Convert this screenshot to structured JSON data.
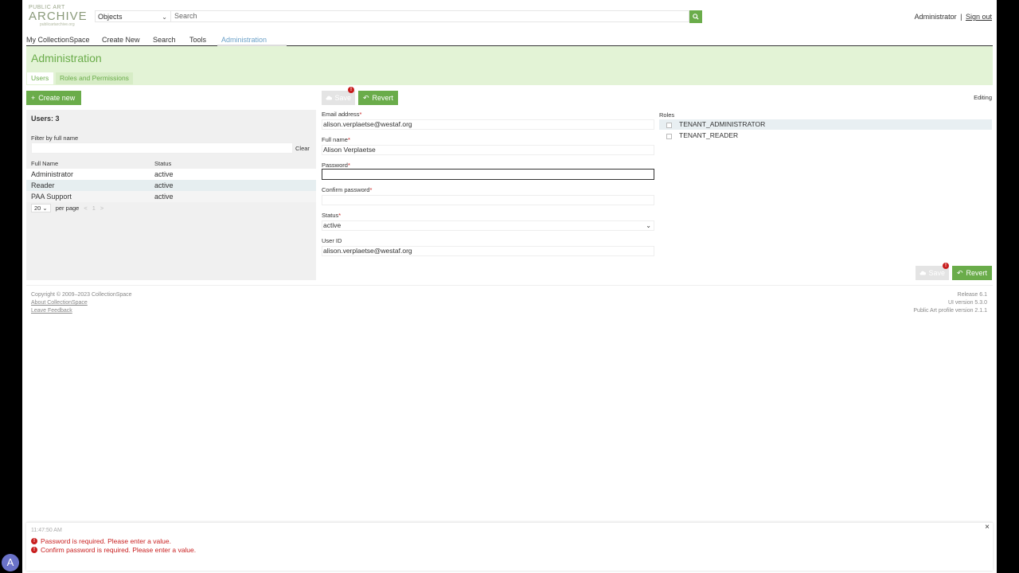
{
  "header": {
    "logo_line1": "PUBLIC ART",
    "logo_line2": "ARCHIVE",
    "logo_line3": "publicartarchive.org",
    "record_type": "Objects",
    "search_placeholder": "Search",
    "user_name": "Administrator",
    "separator": "|",
    "sign_out": "Sign out"
  },
  "nav": {
    "items": [
      "My CollectionSpace",
      "Create New",
      "Search",
      "Tools",
      "Administration"
    ]
  },
  "admin": {
    "title": "Administration",
    "tabs": [
      "Users",
      "Roles and Permissions"
    ]
  },
  "left": {
    "create_new": "Create new",
    "users_count": "Users: 3",
    "filter_label": "Filter by full name",
    "clear": "Clear",
    "columns": [
      "Full Name",
      "Status"
    ],
    "rows": [
      {
        "name": "Administrator",
        "status": "active"
      },
      {
        "name": "Reader",
        "status": "active"
      },
      {
        "name": "PAA Support",
        "status": "active"
      }
    ],
    "page_size": "20",
    "per_page": "per page",
    "page_prev": "<",
    "page_num": "1",
    "page_next": ">"
  },
  "toolbar": {
    "save": "Save",
    "revert": "Revert",
    "editing": "Editing",
    "error_badge": "!"
  },
  "form": {
    "email_label": "Email address",
    "email_value": "alison.verplaetse@westaf.org",
    "fullname_label": "Full name",
    "fullname_value": "Alison Verplaetse",
    "password_label": "Password",
    "password_value": "",
    "confirm_label": "Confirm password",
    "confirm_value": "",
    "status_label": "Status",
    "status_value": "active",
    "userid_label": "User ID",
    "userid_value": "alison.verplaetse@westaf.org",
    "required_mark": "*"
  },
  "roles": {
    "label": "Roles",
    "items": [
      "TENANT_ADMINISTRATOR",
      "TENANT_READER"
    ]
  },
  "footer": {
    "copyright": "Copyright © 2009–2023 CollectionSpace",
    "about": "About CollectionSpace",
    "feedback": "Leave Feedback",
    "release": "Release 6.1",
    "ui_version": "UI version 5.3.0",
    "profile_version": "Public Art profile version 2.1.1"
  },
  "notification": {
    "time": "11:47:50 AM",
    "messages": [
      "Password is required. Please enter a value.",
      "Confirm password is required. Please enter a value."
    ],
    "close": "×"
  },
  "avatar_letter": "A",
  "colors": {
    "accent_green": "#6aac4a",
    "band_green": "#e3f3d6",
    "error_red": "#c81e1e",
    "link_blue": "#6aa0c8"
  }
}
